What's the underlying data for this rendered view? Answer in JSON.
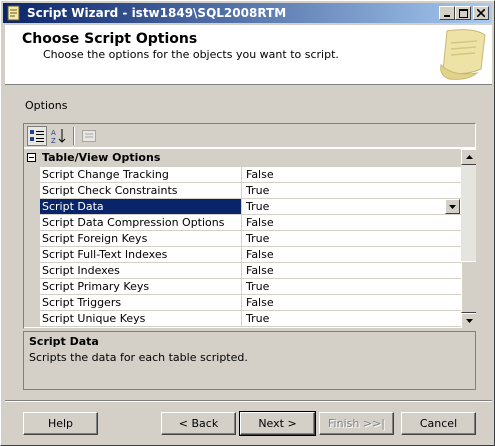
{
  "window": {
    "title": "Script Wizard - istw1849\\SQL2008RTM",
    "controls": {
      "minimize": "_",
      "maximize": "□",
      "close": "×"
    }
  },
  "header": {
    "title": "Choose Script Options",
    "subtitle": "Choose the options for the objects you want to script."
  },
  "options_label": "Options",
  "toolbar": {
    "categorized_icon": "categorized-icon",
    "alphabetical_icon": "alphabetical-sort-icon",
    "property_pages_icon": "property-pages-icon"
  },
  "grid": {
    "category": "Table/View Options",
    "rows": [
      {
        "name": "Script Change Tracking",
        "value": "False"
      },
      {
        "name": "Script Check Constraints",
        "value": "True"
      },
      {
        "name": "Script Data",
        "value": "True"
      },
      {
        "name": "Script Data Compression Options",
        "value": "False"
      },
      {
        "name": "Script Foreign Keys",
        "value": "True"
      },
      {
        "name": "Script Full-Text Indexes",
        "value": "False"
      },
      {
        "name": "Script Indexes",
        "value": "False"
      },
      {
        "name": "Script Primary Keys",
        "value": "True"
      },
      {
        "name": "Script Triggers",
        "value": "False"
      },
      {
        "name": "Script Unique Keys",
        "value": "True"
      }
    ],
    "selected_index": 2
  },
  "description": {
    "title": "Script Data",
    "text": "Scripts the data for each table scripted."
  },
  "buttons": {
    "help": "Help",
    "back": "< Back",
    "next": "Next >",
    "finish": "Finish >>|",
    "cancel": "Cancel"
  },
  "colors": {
    "selection": "#0a246a",
    "face": "#d4d0c8"
  }
}
